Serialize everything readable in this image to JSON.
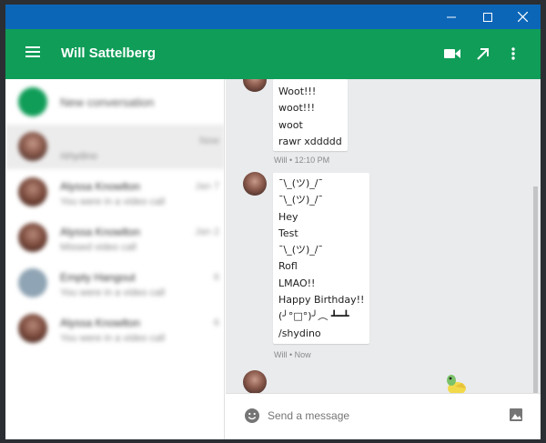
{
  "window": {
    "controls": {
      "minimize": "—",
      "maximize": "☐",
      "close": "✕"
    }
  },
  "appbar": {
    "title": "Will Sattelberg",
    "actions": [
      "videocam-icon",
      "open-in-new-icon",
      "more-vert-icon"
    ],
    "color": "#109d58"
  },
  "titlebar_color": "#0b66b8",
  "sidebar": {
    "new_conversation": "New conversation",
    "items": [
      {
        "name": "",
        "preview": "/shydino",
        "time": "Now"
      },
      {
        "name": "Alyssa Knowlton",
        "preview": "You were in a video call",
        "time": "Jan 7"
      },
      {
        "name": "Alyssa Knowlton",
        "preview": "Missed video call",
        "time": "Jan 2"
      },
      {
        "name": "Empty Hangout",
        "preview": "You were in a video call",
        "time": "6"
      },
      {
        "name": "Alyssa Knowlton",
        "preview": "You were in a video call",
        "time": "6"
      }
    ]
  },
  "chat": {
    "messages": [
      {
        "lines": [
          "Woot!!!",
          "woot!!!",
          "woot",
          "rawr xddddd"
        ],
        "meta": "Will • 12:10 PM"
      },
      {
        "lines": [
          "¯\\_(ツ)_/¯",
          "¯\\_(ツ)_/¯",
          "Hey",
          "Test",
          "¯\\_(ツ)_/¯",
          "Rofl",
          "LMAO!!",
          "Happy Birthday!!",
          "(╯°□°)╯︵ ┻━┻",
          "/shydino"
        ],
        "meta": "Will • Now"
      }
    ]
  },
  "composer": {
    "placeholder": "Send a message",
    "value": ""
  }
}
